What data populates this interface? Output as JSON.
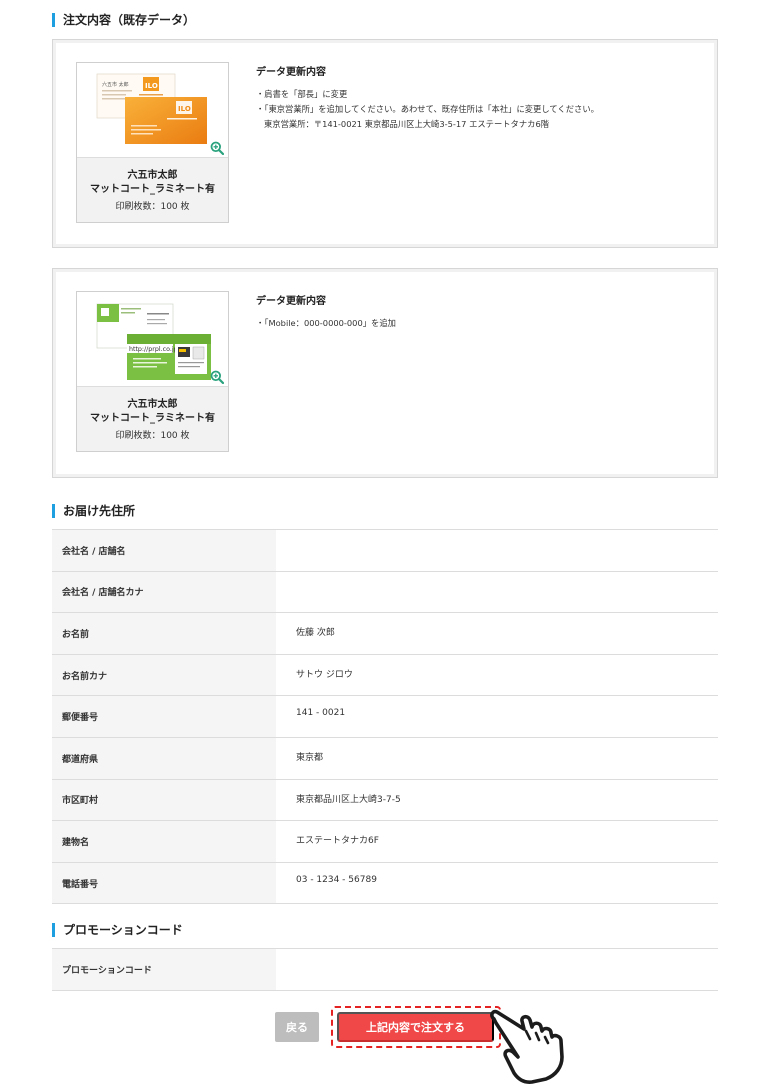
{
  "order_section": {
    "title": "注文内容（既存データ）",
    "items": [
      {
        "name": "六五市太郎",
        "finish": "マットコート_ラミネート有",
        "quantity": "印刷枚数：100 枚",
        "update_heading": "データ更新内容",
        "update_lines": [
          "・肩書を「部長」に変更",
          "・「東京営業所」を追加してください。あわせて、既存住所は「本社」に変更してください。",
          "東京営業所：〒141-0021 東京都品川区上大崎3-5-17 エステートタナカ6階"
        ]
      },
      {
        "name": "六五市太郎",
        "finish": "マットコート_ラミネート有",
        "quantity": "印刷枚数：100 枚",
        "update_heading": "データ更新内容",
        "update_lines": [
          "・「Mobile：000-0000-000」を追加"
        ]
      }
    ],
    "card_text": {
      "name_small": "六五市 太郎",
      "logo_mark": "ILO",
      "url": "http://prpl.co.jp"
    }
  },
  "delivery_section": {
    "title": "お届け先住所",
    "rows": [
      {
        "label": "会社名 / 店舗名",
        "value": ""
      },
      {
        "label": "会社名 / 店舗名カナ",
        "value": ""
      },
      {
        "label": "お名前",
        "value": "佐藤 次郎"
      },
      {
        "label": "お名前カナ",
        "value": "サトウ ジロウ"
      },
      {
        "label": "郵便番号",
        "value": "141 - 0021"
      },
      {
        "label": "都道府県",
        "value": "東京都"
      },
      {
        "label": "市区町村",
        "value": "東京都品川区上大崎3-7-5"
      },
      {
        "label": "建物名",
        "value": "エステートタナカ6F"
      },
      {
        "label": "電話番号",
        "value": "03 - 1234 - 56789"
      }
    ]
  },
  "promo_section": {
    "title": "プロモーションコード",
    "rows": [
      {
        "label": "プロモーションコード",
        "value": ""
      }
    ]
  },
  "actions": {
    "back_label": "戻る",
    "order_label": "上記内容で注文する"
  },
  "colors": {
    "accent": "#1e9fe0",
    "order_button": "#f04848",
    "order_outline": "#e52222",
    "back_button": "#bdbdbd",
    "zoom_icon": "#2aa27d"
  },
  "icons": {
    "zoom": "zoom-in-icon",
    "pointer": "pointing-hand-icon"
  }
}
